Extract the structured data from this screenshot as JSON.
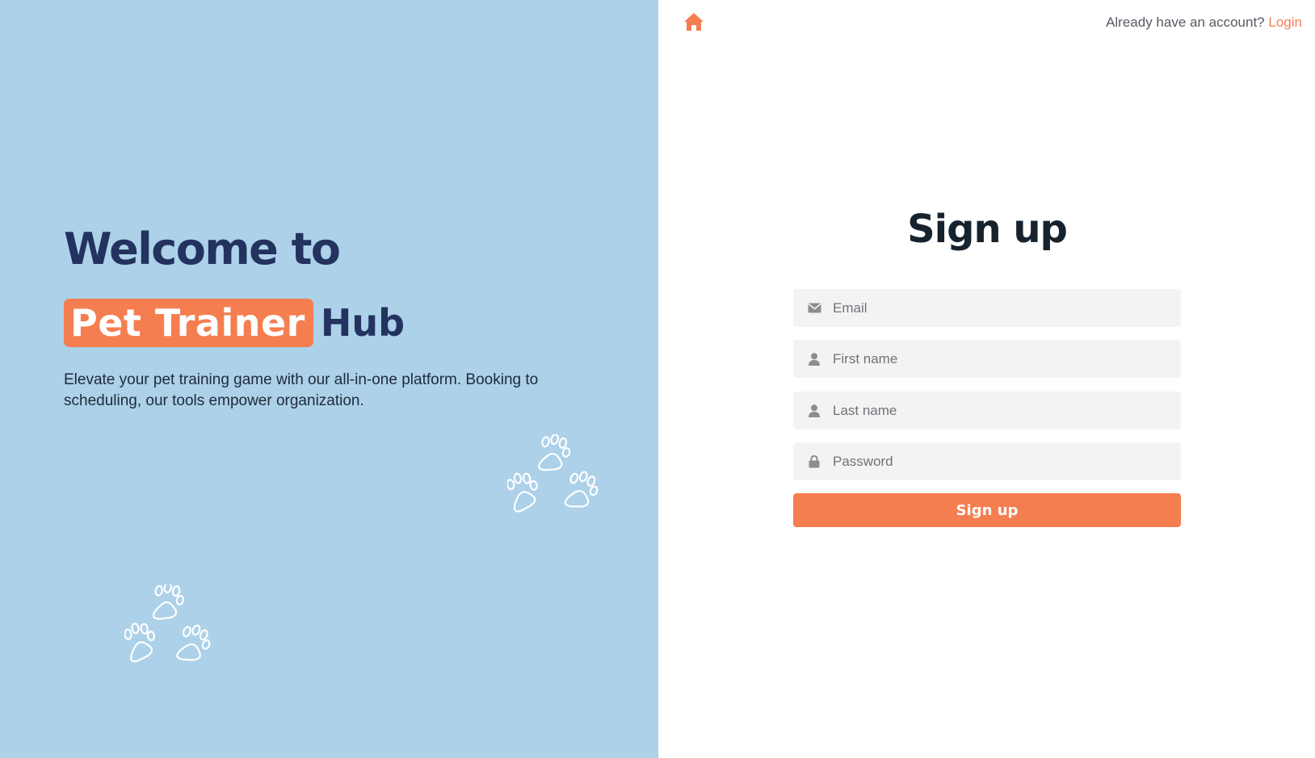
{
  "hero": {
    "title_line1": "Welcome to",
    "highlight": "Pet Trainer",
    "title_suffix": "Hub",
    "description": "Elevate your pet training game with our all-in-one platform. Booking to scheduling, our tools empower organization."
  },
  "topbar": {
    "home_icon": "home-icon",
    "account_prompt": "Already have an account?",
    "login_label": "Login"
  },
  "form": {
    "title": "Sign up",
    "email": {
      "icon": "envelope-icon",
      "placeholder": "Email",
      "value": ""
    },
    "first_name": {
      "icon": "user-icon",
      "placeholder": "First name",
      "value": ""
    },
    "last_name": {
      "icon": "user-icon",
      "placeholder": "Last name",
      "value": ""
    },
    "password": {
      "icon": "lock-icon",
      "placeholder": "Password",
      "value": ""
    },
    "submit_label": "Sign up"
  },
  "colors": {
    "left_panel_bg": "#acd1e8",
    "accent": "#f57e51",
    "heading_navy": "#23325f",
    "input_bg": "#f3f3f3"
  }
}
